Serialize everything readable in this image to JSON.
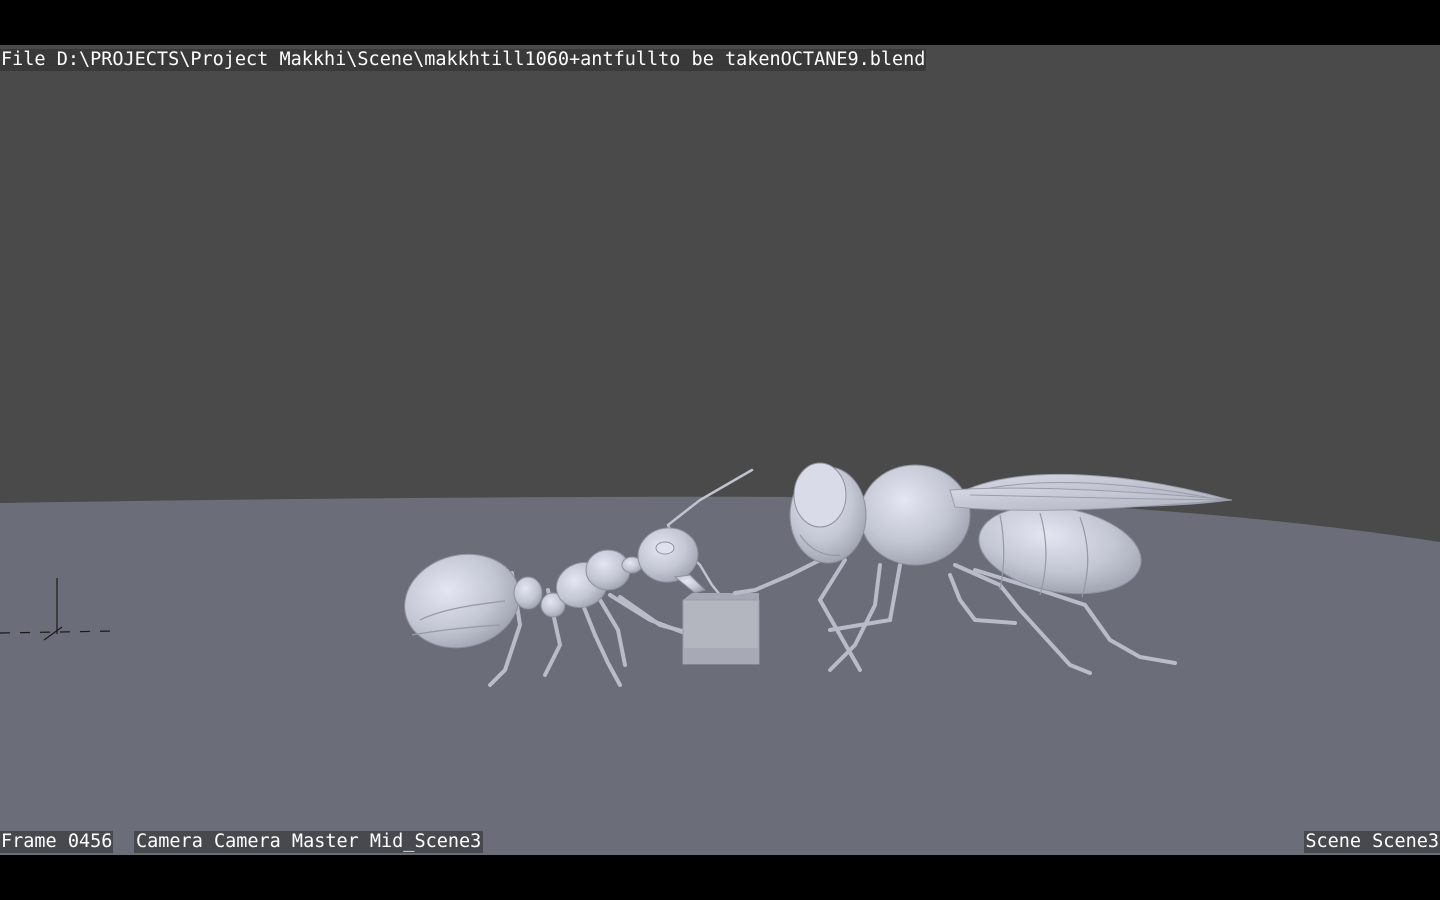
{
  "stamps": {
    "file": "File D:\\PROJECTS\\Project Makkhi\\Scene\\makkhtill1060+antfullto be takenOCTANE9.blend",
    "frame": "Frame 0456",
    "camera": "Camera Camera Master Mid_Scene3",
    "scene": "Scene Scene3"
  },
  "colors": {
    "letterbox": "#000000",
    "backdrop": "#4a4a4a",
    "ground": "#6b6e78",
    "model": "#c9ccd9",
    "stamp_text": "#ffffff"
  },
  "viewport": {
    "objects": [
      "ant-model",
      "fly-model",
      "cube-mesh",
      "empty-axes"
    ]
  }
}
